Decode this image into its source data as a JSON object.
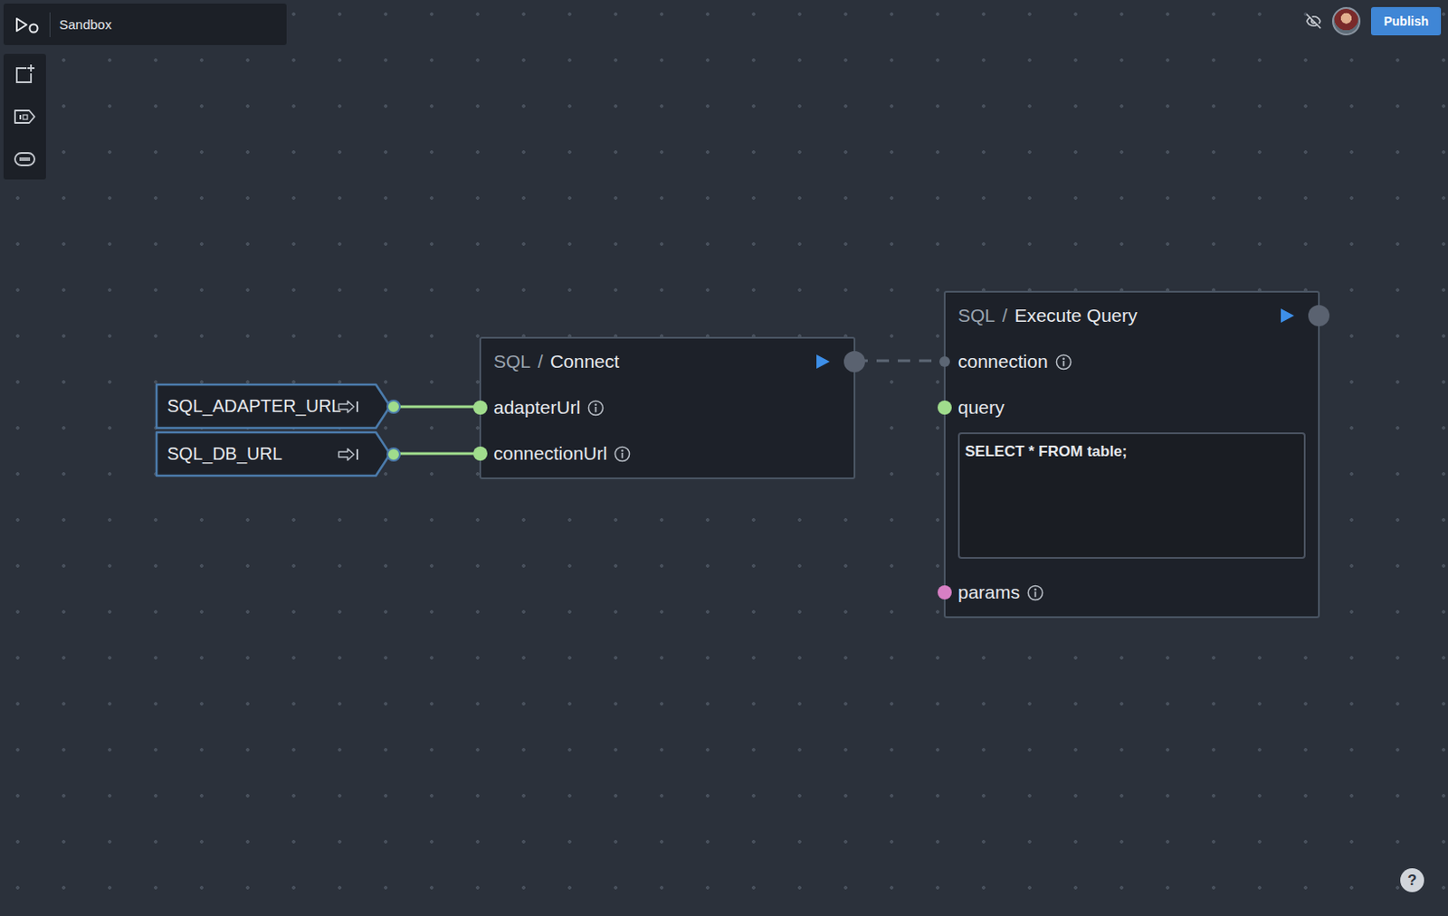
{
  "workspace": {
    "title": "Sandbox"
  },
  "header": {
    "publish_button": "Publish"
  },
  "help": "?",
  "inputs": [
    {
      "name": "SQL_ADAPTER_URL",
      "color": "#a0dc8c"
    },
    {
      "name": "SQL_DB_URL",
      "color": "#a0dc8c"
    }
  ],
  "nodes": [
    {
      "category": "SQL",
      "separator": "/",
      "title": "Connect",
      "ports": [
        {
          "name": "adapterUrl",
          "info": true,
          "color": "#a0dc8c",
          "kind": "input"
        },
        {
          "name": "connectionUrl",
          "info": true,
          "color": "#a0dc8c",
          "kind": "input"
        }
      ]
    },
    {
      "category": "SQL",
      "separator": "/",
      "title": "Execute Query",
      "ports": [
        {
          "name": "connection",
          "info": true,
          "color": "#5c6674",
          "kind": "control"
        },
        {
          "name": "query",
          "info": false,
          "color": "#a0dc8c",
          "kind": "input",
          "value": "SELECT * FROM table;"
        },
        {
          "name": "params",
          "info": true,
          "color": "#d77fc4",
          "kind": "input"
        }
      ]
    }
  ],
  "edges": [
    {
      "from": "SQL_ADAPTER_URL",
      "to": "adapterUrl",
      "kind": "data"
    },
    {
      "from": "SQL_DB_URL",
      "to": "connectionUrl",
      "kind": "data"
    },
    {
      "from": "Connect",
      "to": "connection",
      "kind": "control"
    }
  ]
}
